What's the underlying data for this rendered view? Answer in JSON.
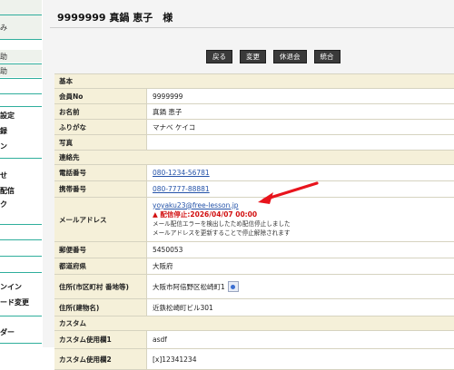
{
  "sidebar": {
    "items": [
      {
        "label": ""
      },
      {
        "label": "み"
      },
      {
        "label": ""
      },
      {
        "label": "助"
      },
      {
        "label": "助"
      },
      {
        "label": "設定"
      },
      {
        "label": "録"
      },
      {
        "label": "ン"
      },
      {
        "label": "せ"
      },
      {
        "label": "配信"
      },
      {
        "label": "ク"
      },
      {
        "label": "ンイン"
      },
      {
        "label": "ード変更"
      },
      {
        "label": "ダー"
      }
    ]
  },
  "page": {
    "title": "9999999 真鍋 恵子　様",
    "buttons": {
      "back": "戻る",
      "edit": "変更",
      "withdraw": "休退会",
      "merge": "統合"
    }
  },
  "table": {
    "section_basic": "基本",
    "member_no": {
      "label": "会員No",
      "value": "9999999"
    },
    "name": {
      "label": "お名前",
      "value": "真鍋 恵子"
    },
    "furigana": {
      "label": "ふりがな",
      "value": "マナベ ケイコ"
    },
    "photo": {
      "label": "写真",
      "value": ""
    },
    "section_contact": "連絡先",
    "phone": {
      "label": "電話番号",
      "value": "080-1234-56781"
    },
    "mobile": {
      "label": "携帯番号",
      "value": "080-7777-88881"
    },
    "email": {
      "label": "メールアドレス",
      "value": "yoyaku23@free-lesson.jp",
      "warning": "配信停止:2026/04/07 00:00",
      "note1": "メール配信エラーを検出したため配信停止しました",
      "note2": "メールアドレスを更新することで停止解除されます"
    },
    "postal": {
      "label": "郵便番号",
      "value": "5450053"
    },
    "prefecture": {
      "label": "都道府県",
      "value": "大阪府"
    },
    "address": {
      "label": "住所(市区町村 番地等)",
      "value": "大阪市阿倍野区松崎町1"
    },
    "building": {
      "label": "住所(建物名)",
      "value": "近鉄松崎町ビル301"
    },
    "section_custom": "カスタム",
    "custom1": {
      "label": "カスタム使用欄1",
      "value": "asdf"
    },
    "custom2": {
      "label": "カスタム使用欄2",
      "value": "[x]12341234"
    }
  },
  "colors": {
    "warning": "#d20f0f",
    "link": "#2352a8",
    "label_bg": "#f5f0d9",
    "arrow": "#e8141c"
  }
}
